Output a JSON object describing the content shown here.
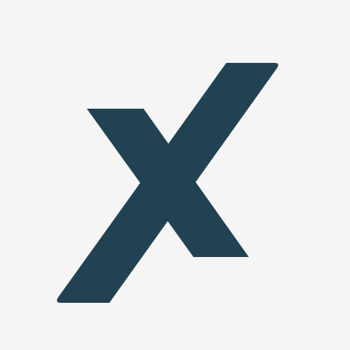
{
  "icon": {
    "name": "x-logo-icon",
    "background_color": "#F5F5F5",
    "mark_color": "#224254"
  }
}
